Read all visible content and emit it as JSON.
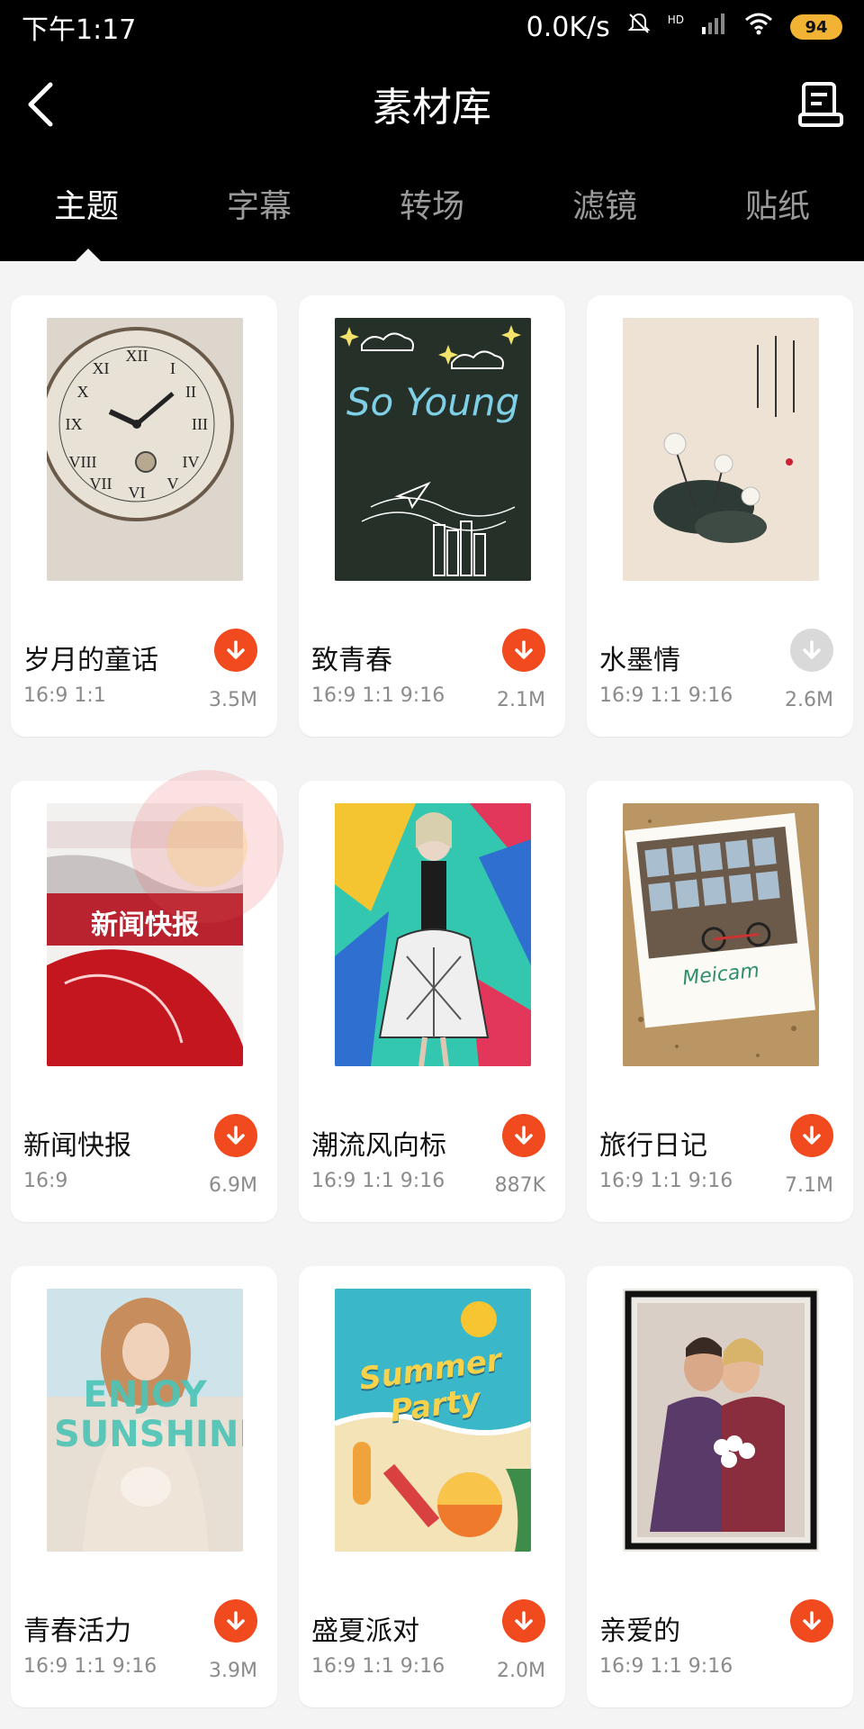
{
  "status": {
    "time": "下午1:17",
    "speed": "0.0K/s",
    "network": "HD",
    "battery": "94"
  },
  "nav": {
    "title": "素材库",
    "back_icon": "chevron-left-icon",
    "right_icon": "document-icon"
  },
  "tabs": [
    {
      "label": "主题",
      "active": true
    },
    {
      "label": "字幕",
      "active": false
    },
    {
      "label": "转场",
      "active": false
    },
    {
      "label": "滤镜",
      "active": false
    },
    {
      "label": "贴纸",
      "active": false
    }
  ],
  "colors": {
    "accent": "#f24a1f",
    "download_disabled": "#d9d9d9",
    "page_bg": "#f4f4f4"
  },
  "items": [
    {
      "name": "岁月的童话",
      "ratios": "16:9 1:1",
      "size": "3.5M",
      "download_enabled": true,
      "thumb_text": ""
    },
    {
      "name": "致青春",
      "ratios": "16:9 1:1 9:16",
      "size": "2.1M",
      "download_enabled": true,
      "thumb_text": "So Young"
    },
    {
      "name": "水墨情",
      "ratios": "16:9 1:1 9:16",
      "size": "2.6M",
      "download_enabled": false,
      "thumb_text": ""
    },
    {
      "name": "新闻快报",
      "ratios": "16:9",
      "size": "6.9M",
      "download_enabled": true,
      "thumb_text": "新闻快报"
    },
    {
      "name": "潮流风向标",
      "ratios": "16:9 1:1 9:16",
      "size": "887K",
      "download_enabled": true,
      "thumb_text": ""
    },
    {
      "name": "旅行日记",
      "ratios": "16:9 1:1 9:16",
      "size": "7.1M",
      "download_enabled": true,
      "thumb_text": "Meicam"
    },
    {
      "name": "青春活力",
      "ratios": "16:9 1:1 9:16",
      "size": "3.9M",
      "download_enabled": true,
      "thumb_text": "ENJOY SUNSHINE"
    },
    {
      "name": "盛夏派对",
      "ratios": "16:9 1:1 9:16",
      "size": "2.0M",
      "download_enabled": true,
      "thumb_text": "Summer Party"
    },
    {
      "name": "亲爱的",
      "ratios": "16:9 1:1 9:16",
      "size": "",
      "download_enabled": true,
      "thumb_text": ""
    }
  ]
}
